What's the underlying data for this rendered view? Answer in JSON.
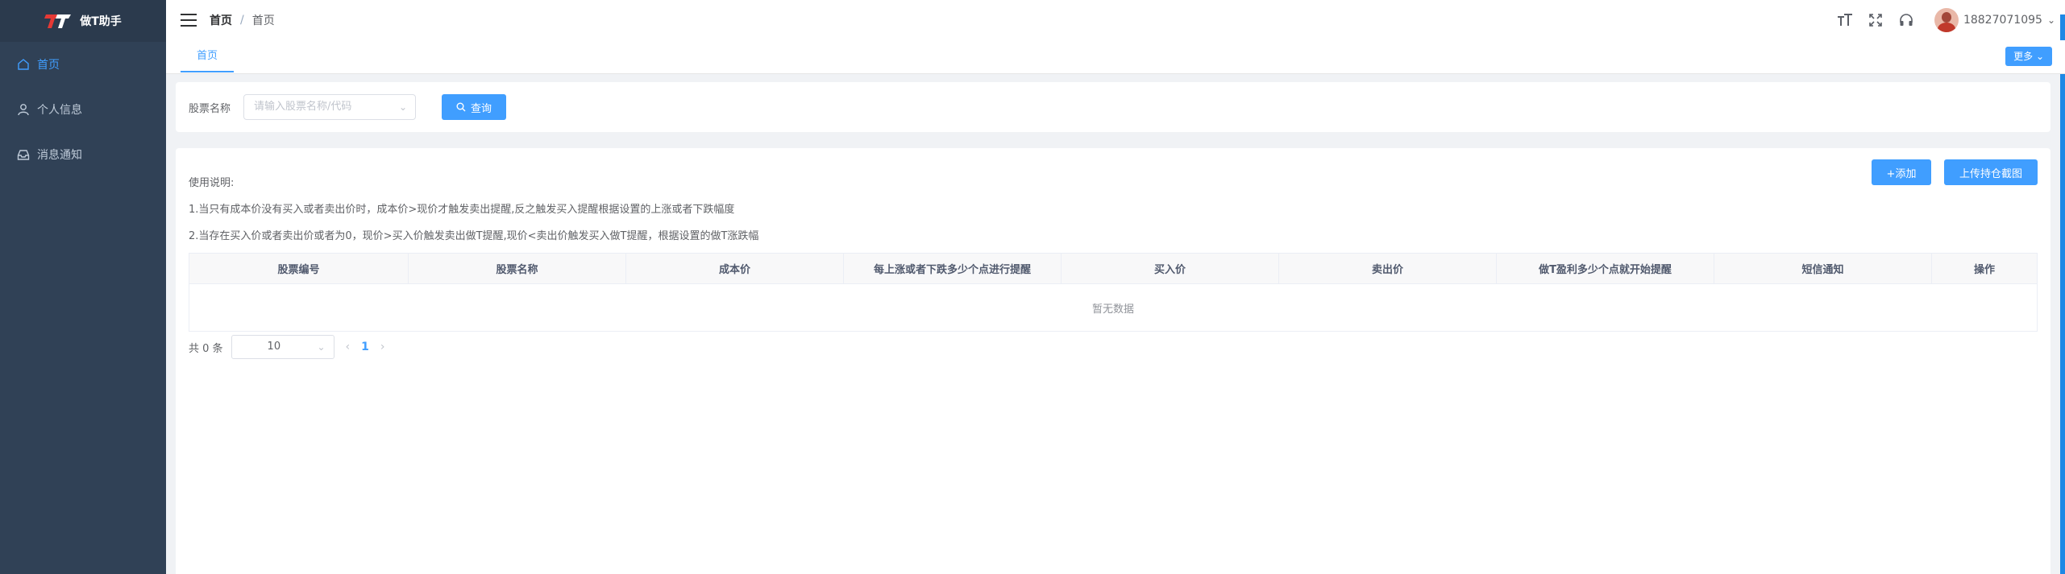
{
  "app": {
    "name": "做T助手"
  },
  "sidebar": {
    "items": [
      {
        "label": "首页",
        "icon": "home-icon",
        "active": true
      },
      {
        "label": "个人信息",
        "icon": "user-icon",
        "active": false
      },
      {
        "label": "消息通知",
        "icon": "inbox-icon",
        "active": false
      }
    ]
  },
  "header": {
    "breadcrumb": [
      "首页",
      "首页"
    ],
    "breadcrumb_separator": "/",
    "username": "18827071095"
  },
  "tags": {
    "active_tag": "首页",
    "more_label": "更多"
  },
  "search": {
    "label": "股票名称",
    "placeholder": "请输入股票名称/代码",
    "query_label": "查询"
  },
  "main": {
    "usage_title": "使用说明:",
    "usage_lines": [
      "1.当只有成本价没有买入或者卖出价时，成本价>现价才触发卖出提醒,反之触发买入提醒根据设置的上涨或者下跌幅度",
      "2.当存在买入价或者卖出价或者为0，现价>买入价触发卖出做T提醒,现价<卖出价触发买入做T提醒，根据设置的做T涨跌幅"
    ],
    "add_label": "+添加",
    "upload_label": "上传持仓截图"
  },
  "table": {
    "columns": [
      "股票编号",
      "股票名称",
      "成本价",
      "每上涨或者下跌多少个点进行提醒",
      "买入价",
      "卖出价",
      "做T盈利多少个点就开始提醒",
      "短信通知",
      "操作"
    ],
    "empty_text": "暂无数据"
  },
  "pagination": {
    "total_text": "共 0 条",
    "page_size": "10",
    "current_page": "1"
  },
  "colors": {
    "sidebar_bg": "#304156",
    "accent": "#409eff"
  }
}
